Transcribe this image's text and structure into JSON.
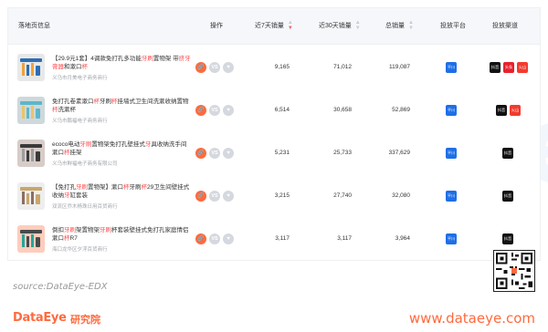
{
  "table": {
    "headers": {
      "info": "落地页信息",
      "ops": "操作",
      "sales7": "近7天销量",
      "sales30": "近30天销量",
      "total": "总销量",
      "platform": "投放平台",
      "channel": "投放渠道"
    },
    "rows": [
      {
        "title_parts": [
          "【29.9元1套】4调款免打孔多功能",
          "牙刷",
          "置物架 带",
          "挤牙膏器",
          "和漱口",
          "杯",
          ""
        ],
        "shop": "义乌市月美电子商务商行",
        "sales7": "9,165",
        "sales30": "71,012",
        "total": "119,087",
        "platform": "平川",
        "channels": [
          "抖音",
          "头条",
          "火山"
        ]
      },
      {
        "title_parts": [
          "免打孔卷素漱口",
          "杯",
          "牙刷",
          "杯",
          "挂墙式卫生间洗漱收纳置物",
          "杯",
          "洗漱杯"
        ],
        "shop": "义乌市鹏福电子商务商行",
        "sales7": "6,514",
        "sales30": "30,658",
        "total": "52,869",
        "platform": "平川",
        "channels": [
          "抖音",
          "火山"
        ]
      },
      {
        "title_parts": [
          "ecoco电动",
          "牙刷",
          "置物架免打孔壁挂式",
          "牙",
          "具收纳洗手间漱口",
          "杯",
          "挂架"
        ],
        "shop": "义乌市鲜福电子商务有限公司",
        "sales7": "5,231",
        "sales30": "25,733",
        "total": "337,629",
        "platform": "平川",
        "channels": [
          "抖音"
        ]
      },
      {
        "title_parts": [
          "【免打孔",
          "牙刷",
          "置物架】漱口",
          "杯",
          "牙刷",
          "杯",
          "29卫生间壁挂式收纳",
          "牙",
          "缸套装"
        ],
        "shop": "双流区乔木杨珠日用百货商行",
        "sales7": "3,215",
        "sales30": "27,740",
        "total": "32,080",
        "platform": "平川",
        "channels": [
          "抖音"
        ]
      },
      {
        "title_parts": [
          "倒扣",
          "牙刷",
          "架置物架",
          "牙刷",
          "杯套装壁挂式免打孔家庭情侣漱口",
          "杯",
          "R7"
        ],
        "shop": "海口龙华区夕浮百货商行",
        "sales7": "3,117",
        "sales30": "3,117",
        "total": "3,964",
        "platform": "平川",
        "channels": [
          "抖音"
        ]
      }
    ]
  },
  "op_labels": {
    "vs": "VS",
    "link": "🔗",
    "fav": "♥"
  },
  "source": "source:DataEye-EDX",
  "footer": {
    "brand": "DataEye",
    "brand_sub": "研究院",
    "site": "www.dataeye.com"
  },
  "watermark": "DataEye",
  "colors": {
    "accent": "#ff6a3d",
    "highlight": "#ff4d4f",
    "platform_blue": "#1e6fe6",
    "douyin": "#111111",
    "toutiao": "#e8212c"
  }
}
